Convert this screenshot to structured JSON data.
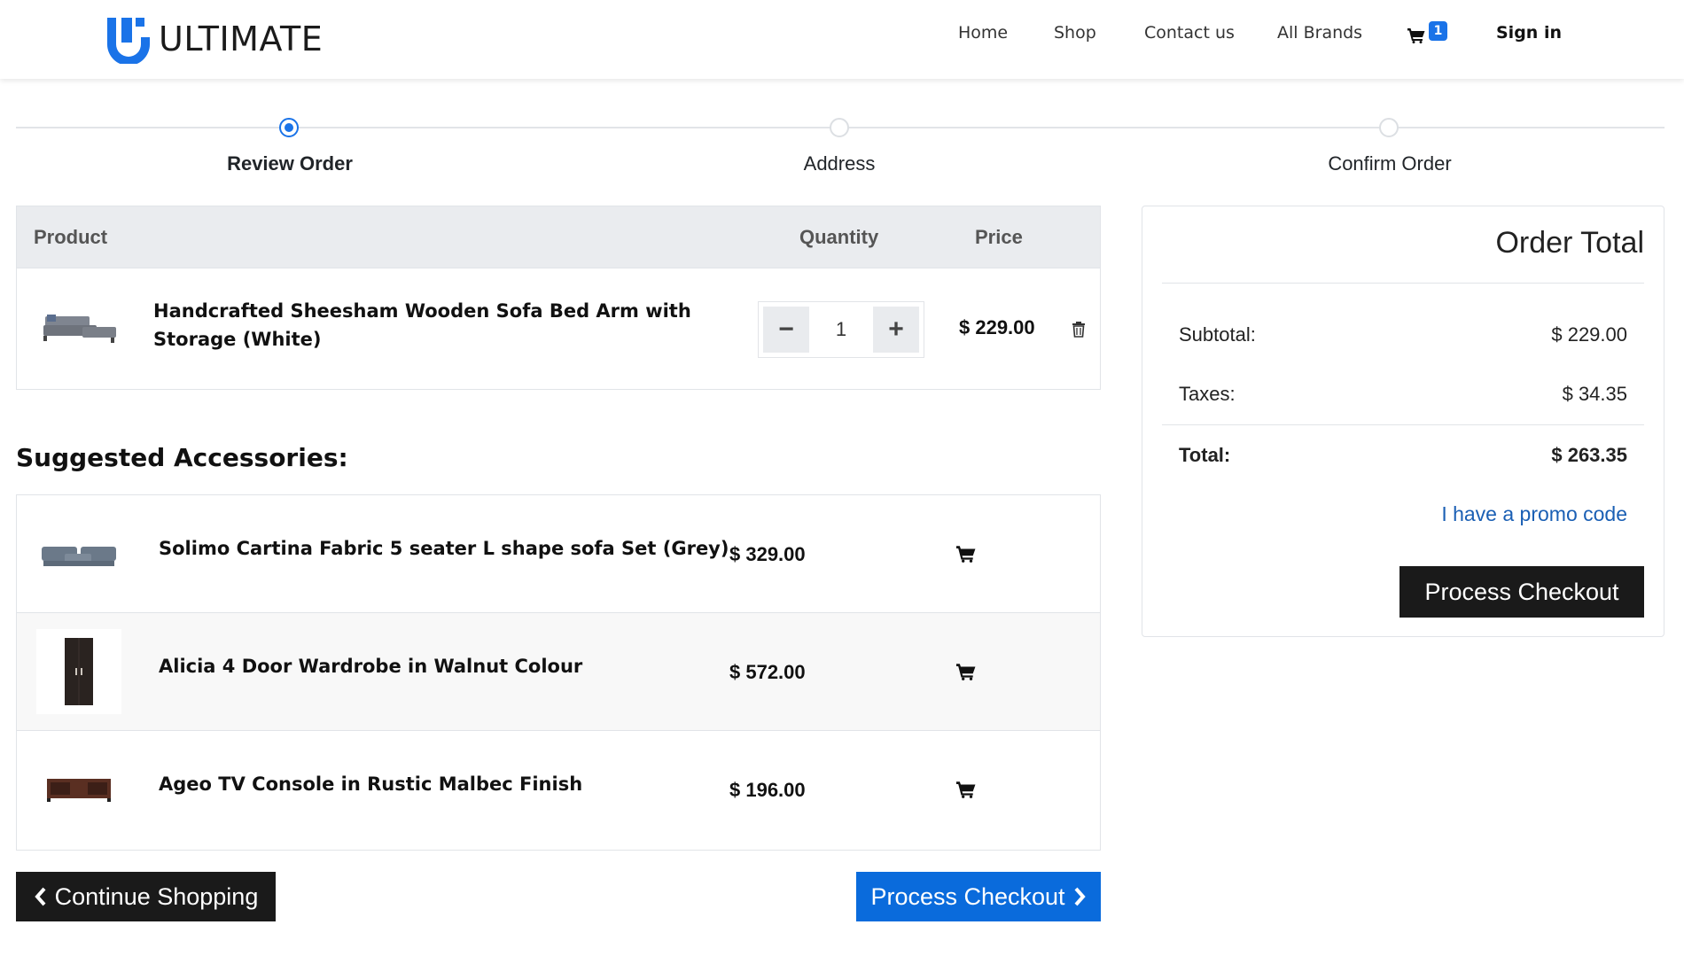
{
  "brand": {
    "name": "ULTIMATE"
  },
  "nav": {
    "home": "Home",
    "shop": "Shop",
    "contact": "Contact us",
    "brands": "All Brands",
    "cart_count": "1",
    "signin": "Sign in"
  },
  "steps": [
    "Review Order",
    "Address",
    "Confirm Order"
  ],
  "cart": {
    "headers": {
      "product": "Product",
      "quantity": "Quantity",
      "price": "Price"
    },
    "item": {
      "name": "Handcrafted Sheesham Wooden Sofa Bed Arm with Storage (White)",
      "quantity": "1",
      "price": "$ 229.00"
    }
  },
  "suggested": {
    "title": "Suggested Accessories:",
    "items": [
      {
        "name": "Solimo Cartina Fabric 5 seater L shape sofa Set (Grey)",
        "price": "$ 329.00"
      },
      {
        "name": "Alicia 4 Door Wardrobe in Walnut Colour",
        "price": "$ 572.00"
      },
      {
        "name": "Ageo TV Console in Rustic Malbec Finish",
        "price": "$ 196.00"
      }
    ]
  },
  "buttons": {
    "continue": "Continue Shopping",
    "process": "Process Checkout"
  },
  "order_total": {
    "title": "Order Total",
    "subtotal_label": "Subtotal:",
    "subtotal": "$ 229.00",
    "taxes_label": "Taxes:",
    "taxes": "$ 34.35",
    "total_label": "Total:",
    "total": "$ 263.35",
    "promo": "I have a promo code",
    "checkout": "Process Checkout"
  },
  "colors": {
    "accent": "#1a73e8",
    "button_dark": "#1a1a1a",
    "button_blue": "#0a6bdc",
    "link": "#1a5fb4"
  }
}
